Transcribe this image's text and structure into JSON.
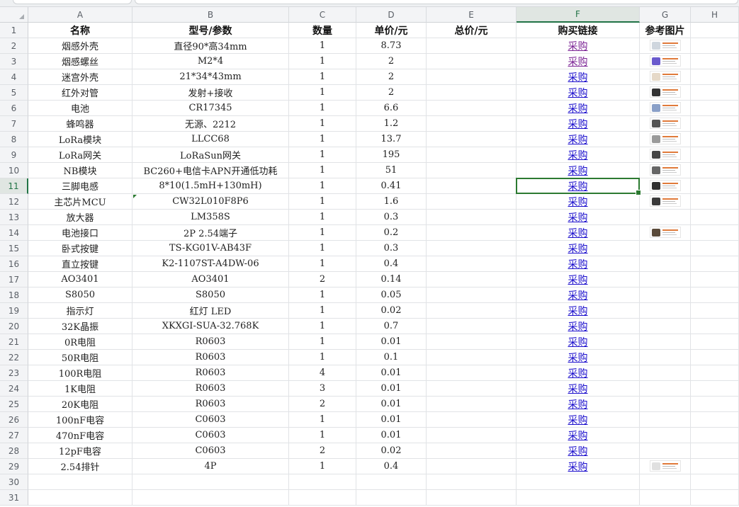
{
  "columns": [
    "A",
    "B",
    "C",
    "D",
    "E",
    "F",
    "G",
    "H"
  ],
  "active_column": "F",
  "active_row": 11,
  "header_row": [
    "名称",
    "型号/参数",
    "数量",
    "单价/元",
    "总价/元",
    "购买链接",
    "参考图片"
  ],
  "link_label": "采购",
  "items": [
    {
      "name": "烟感外壳",
      "model": "直径90*高34mm",
      "qty": "1",
      "price": "8.73",
      "visited": true,
      "thumb": "smoke-shell-thumbnail-icon"
    },
    {
      "name": "烟感螺丝",
      "model": "M2*4",
      "qty": "1",
      "price": "2",
      "visited": true,
      "thumb": "screw-thumbnail-icon"
    },
    {
      "name": "迷宫外壳",
      "model": "21*34*43mm",
      "qty": "1",
      "price": "2",
      "visited": false,
      "thumb": "maze-shell-thumbnail-icon"
    },
    {
      "name": "红外对管",
      "model": "发射+接收",
      "qty": "1",
      "price": "2",
      "visited": false,
      "thumb": "infrared-pair-thumbnail-icon"
    },
    {
      "name": "电池",
      "model": "CR17345",
      "qty": "1",
      "price": "6.6",
      "visited": false,
      "thumb": "battery-thumbnail-icon"
    },
    {
      "name": "蜂鸣器",
      "model": "无源、2212",
      "qty": "1",
      "price": "1.2",
      "visited": false,
      "thumb": "buzzer-thumbnail-icon"
    },
    {
      "name": "LoRa模块",
      "model": "LLCC68",
      "qty": "1",
      "price": "13.7",
      "visited": false,
      "thumb": "lora-module-thumbnail-icon"
    },
    {
      "name": "LoRa网关",
      "model": "LoRaSun网关",
      "qty": "1",
      "price": "195",
      "visited": false,
      "thumb": "lora-gateway-thumbnail-icon"
    },
    {
      "name": "NB模块",
      "model": "BC260+电信卡APN开通低功耗",
      "qty": "1",
      "price": "51",
      "visited": false,
      "thumb": "nb-module-thumbnail-icon"
    },
    {
      "name": "三脚电感",
      "model": "8*10(1.5mH+130mH)",
      "qty": "1",
      "price": "0.41",
      "visited": false,
      "thumb": "inductor-thumbnail-icon"
    },
    {
      "name": "主芯片MCU",
      "model": "CW32L010F8P6",
      "qty": "1",
      "price": "1.6",
      "visited": false,
      "thumb": "mcu-thumbnail-icon"
    },
    {
      "name": "放大器",
      "model": "LM358S",
      "qty": "1",
      "price": "0.3",
      "visited": false,
      "thumb": ""
    },
    {
      "name": "电池接口",
      "model": "2P 2.54端子",
      "qty": "1",
      "price": "0.2",
      "visited": false,
      "thumb": "battery-connector-thumbnail-icon"
    },
    {
      "name": "卧式按键",
      "model": "TS-KG01V-AB43F",
      "qty": "1",
      "price": "0.3",
      "visited": false,
      "thumb": ""
    },
    {
      "name": "直立按键",
      "model": "K2-1107ST-A4DW-06",
      "qty": "1",
      "price": "0.4",
      "visited": false,
      "thumb": ""
    },
    {
      "name": "AO3401",
      "model": "AO3401",
      "qty": "2",
      "price": "0.14",
      "visited": false,
      "thumb": ""
    },
    {
      "name": "S8050",
      "model": "S8050",
      "qty": "1",
      "price": "0.05",
      "visited": false,
      "thumb": ""
    },
    {
      "name": "指示灯",
      "model": "红灯 LED",
      "qty": "1",
      "price": "0.02",
      "visited": false,
      "thumb": ""
    },
    {
      "name": "32K晶振",
      "model": "XKXGI-SUA-32.768K",
      "qty": "1",
      "price": "0.7",
      "visited": false,
      "thumb": ""
    },
    {
      "name": "0R电阻",
      "model": "R0603",
      "qty": "1",
      "price": "0.01",
      "visited": false,
      "thumb": ""
    },
    {
      "name": "50R电阻",
      "model": "R0603",
      "qty": "1",
      "price": "0.1",
      "visited": false,
      "thumb": ""
    },
    {
      "name": "100R电阻",
      "model": "R0603",
      "qty": "4",
      "price": "0.01",
      "visited": false,
      "thumb": ""
    },
    {
      "name": "1K电阻",
      "model": "R0603",
      "qty": "3",
      "price": "0.01",
      "visited": false,
      "thumb": ""
    },
    {
      "name": "20K电阻",
      "model": "R0603",
      "qty": "2",
      "price": "0.01",
      "visited": false,
      "thumb": ""
    },
    {
      "name": "100nF电容",
      "model": "C0603",
      "qty": "1",
      "price": "0.01",
      "visited": false,
      "thumb": ""
    },
    {
      "name": "470nF电容",
      "model": "C0603",
      "qty": "1",
      "price": "0.01",
      "visited": false,
      "thumb": ""
    },
    {
      "name": "12pF电容",
      "model": "C0603",
      "qty": "2",
      "price": "0.02",
      "visited": false,
      "thumb": ""
    },
    {
      "name": "2.54排针",
      "model": "4P",
      "qty": "1",
      "price": "0.4",
      "visited": false,
      "thumb": "pin-header-thumbnail-icon"
    }
  ],
  "empty_rows": 2,
  "colors": {
    "link": "#1a0dcc",
    "link_visited": "#7b2394",
    "selection": "#2c7a31",
    "active_header": "#217346"
  }
}
